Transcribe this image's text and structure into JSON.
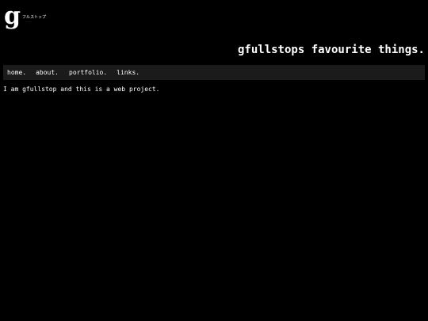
{
  "logo": {
    "mark": "g",
    "kana": "フルストップ"
  },
  "header": {
    "title": "gfullstops favourite things."
  },
  "nav": {
    "items": [
      {
        "label": "home."
      },
      {
        "label": "about."
      },
      {
        "label": "portfolio."
      },
      {
        "label": "links."
      }
    ]
  },
  "main": {
    "intro": "I am gfullstop and this is a web project."
  },
  "colors": {
    "background": "#000000",
    "nav_bar": "#1b1b1b",
    "text": "#ffffff"
  }
}
